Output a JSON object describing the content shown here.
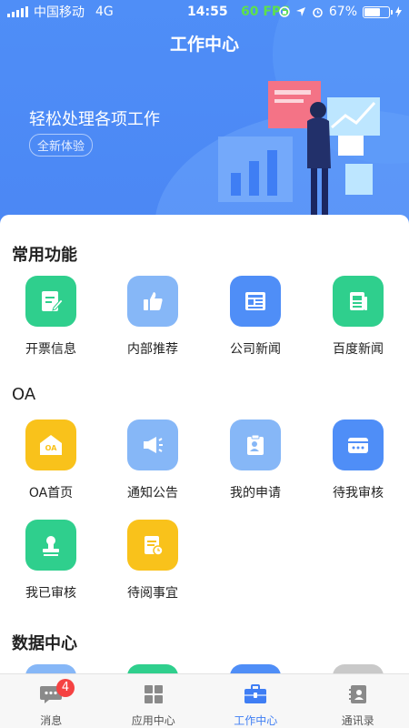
{
  "status_bar": {
    "carrier": "中国移动",
    "network": "4G",
    "time": "14:55",
    "fps": "60 FPS",
    "battery": "67%",
    "battery_level": 0.67
  },
  "header": {
    "title": "工作中心",
    "slogan": "轻松处理各项工作",
    "tag": "全新体验"
  },
  "sections": {
    "common": {
      "title": "常用功能",
      "items": [
        {
          "label": "开票信息",
          "icon": "invoice-edit-icon"
        },
        {
          "label": "内部推荐",
          "icon": "thumbs-up-icon"
        },
        {
          "label": "公司新闻",
          "icon": "news-icon"
        },
        {
          "label": "百度新闻",
          "icon": "newspaper-icon"
        }
      ]
    },
    "oa": {
      "title": "OA",
      "items": [
        {
          "label": "OA首页",
          "icon": "oa-home-icon",
          "icon_text": "OA"
        },
        {
          "label": "通知公告",
          "icon": "megaphone-icon"
        },
        {
          "label": "我的申请",
          "icon": "clipboard-icon"
        },
        {
          "label": "待我审核",
          "icon": "card-icon"
        },
        {
          "label": "我已审核",
          "icon": "stamp-icon"
        },
        {
          "label": "待阅事宜",
          "icon": "document-clock-icon"
        }
      ]
    },
    "data": {
      "title": "数据中心"
    }
  },
  "tabbar": {
    "tabs": [
      {
        "label": "消息",
        "icon": "message-icon",
        "badge": "4"
      },
      {
        "label": "应用中心",
        "icon": "apps-grid-icon"
      },
      {
        "label": "工作中心",
        "icon": "briefcase-icon",
        "active": true
      },
      {
        "label": "通讯录",
        "icon": "contacts-icon"
      }
    ]
  },
  "colors": {
    "primary": "#4f8ef7",
    "green": "#2fcf8d",
    "light_blue": "#86b7f7",
    "yellow": "#f9c21b",
    "badge_red": "#f54242"
  }
}
